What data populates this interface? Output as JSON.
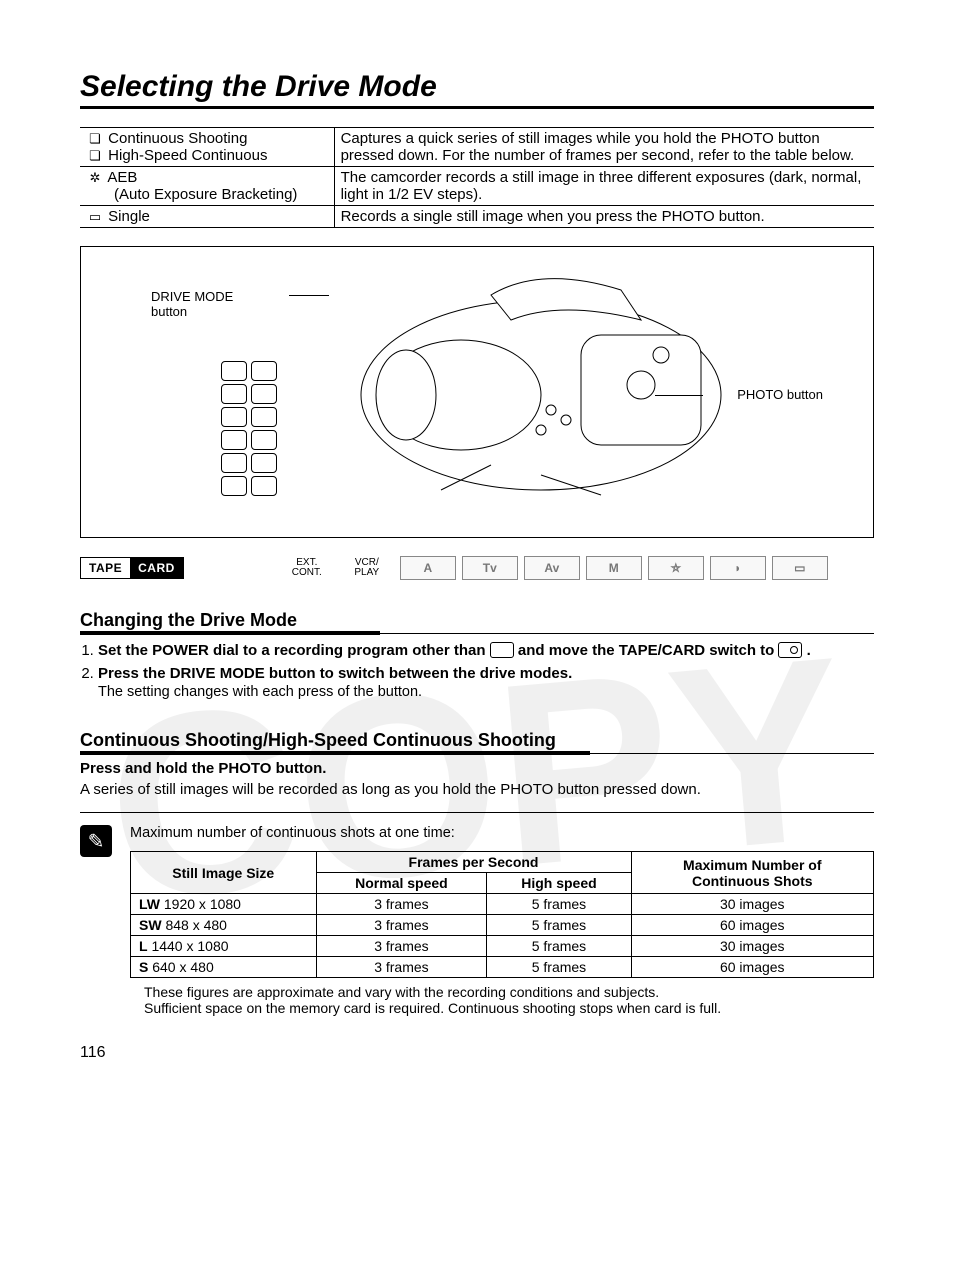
{
  "watermark": "COPY",
  "title": "Selecting the Drive Mode",
  "modes_table": {
    "rows": [
      {
        "left_lines": [
          "Continuous Shooting",
          "High-Speed Continuous"
        ],
        "icons": [
          "❏",
          "❏"
        ],
        "right": "Captures a quick series of still images while you hold the PHOTO button pressed down. For the number of frames per second, refer to the table below."
      },
      {
        "left_lines": [
          "AEB",
          "(Auto Exposure Bracketing)"
        ],
        "icons": [
          "✲",
          ""
        ],
        "right": "The camcorder records a still image in three different exposures (dark, normal, light in 1/2 EV steps)."
      },
      {
        "left_lines": [
          "Single"
        ],
        "icons": [
          "▭"
        ],
        "right": "Records a single still image when you press the PHOTO button."
      }
    ]
  },
  "diagram": {
    "drive_label_l1": "DRIVE MODE",
    "drive_label_l2": "button",
    "photo_label": "PHOTO button"
  },
  "mode_bar": {
    "tape": "TAPE",
    "card": "CARD",
    "ext_cont_l1": "EXT.",
    "ext_cont_l2": "CONT.",
    "vcr_play_l1": "VCR/",
    "vcr_play_l2": "PLAY",
    "a": "A",
    "tv": "Tv",
    "av": "Av",
    "m": "M",
    "night": "⛤",
    "scn": "◗",
    "card_icon": "▭"
  },
  "section1": {
    "heading": "Changing the Drive Mode",
    "step1_pre": "Set the POWER dial to a recording program other than ",
    "step1_post": " and move the TAPE/CARD switch to ",
    "step1_end": " .",
    "step2_title": "Press the DRIVE MODE button to switch between the drive modes.",
    "step2_sub": "The setting changes with each press of the button."
  },
  "section2": {
    "heading": "Continuous Shooting/High-Speed Continuous Shooting",
    "sub_bold": "Press and hold the PHOTO button.",
    "body": "A series of still images will be recorded as long as you hold the PHOTO button pressed down."
  },
  "note": {
    "intro": "Maximum number of continuous shots at one time:",
    "headers": {
      "size": "Still Image Size",
      "fps": "Frames per Second",
      "normal": "Normal speed",
      "high": "High speed",
      "max_l1": "Maximum Number of",
      "max_l2": "Continuous Shots"
    },
    "rows": [
      {
        "code": "LW",
        "size": "1920 x 1080",
        "normal": "3 frames",
        "high": "5 frames",
        "max": "30 images"
      },
      {
        "code": "SW",
        "size": "848 x 480",
        "normal": "3 frames",
        "high": "5 frames",
        "max": "60 images"
      },
      {
        "code": "L",
        "size": "1440 x 1080",
        "normal": "3 frames",
        "high": "5 frames",
        "max": "30 images"
      },
      {
        "code": "S",
        "size": "640 x 480",
        "normal": "3 frames",
        "high": "5 frames",
        "max": "60 images"
      }
    ],
    "footnote1": "These figures are approximate and vary with the recording conditions and subjects.",
    "footnote2": "Sufficient space on the memory card is required. Continuous shooting stops when card is full."
  },
  "page_number": "116"
}
